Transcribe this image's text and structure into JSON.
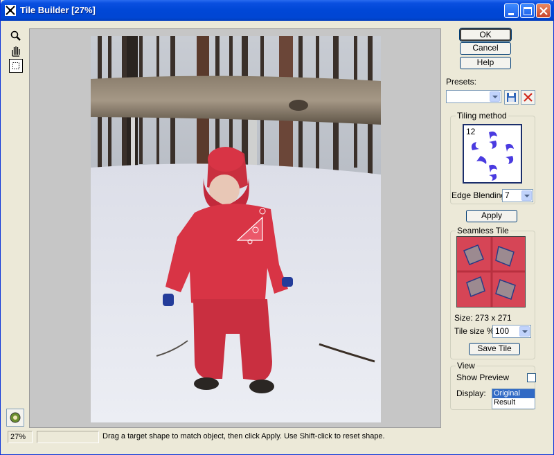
{
  "window": {
    "title": "Tile Builder [27%]",
    "minimize_icon": "minimize-icon",
    "maximize_icon": "maximize-icon",
    "close_icon": "close-icon"
  },
  "tools": [
    "zoom-icon",
    "hand-icon",
    "marquee-select-icon"
  ],
  "buttons": {
    "ok": "OK",
    "cancel": "Cancel",
    "help": "Help",
    "apply": "Apply",
    "save_tile": "Save Tile"
  },
  "presets": {
    "label": "Presets:",
    "value": "",
    "save_icon": "floppy-save-icon",
    "delete_icon": "delete-x-icon"
  },
  "tiling": {
    "group_title": "Tiling method",
    "method_number": "12",
    "edge_blending_label": "Edge Blending",
    "edge_blending_value": "7"
  },
  "seamless": {
    "group_title": "Seamless Tile",
    "size_text": "Size: 273 x 271",
    "tile_size_label": "Tile size %:",
    "tile_size_value": "100"
  },
  "view": {
    "group_title": "View",
    "show_preview_label": "Show Preview",
    "show_preview_checked": false,
    "display_label": "Display:",
    "display_options": [
      "Original",
      "Result"
    ],
    "display_selected": "Original"
  },
  "status": {
    "zoom": "27%",
    "progress": "",
    "message": "Drag a target shape to match object, then click Apply. Use Shift-click to reset shape."
  },
  "colors": {
    "titlebar": "#0047d6",
    "dialog_bg": "#ece9d8",
    "selection": "#316ac5",
    "snowsuit": "#d2374c"
  }
}
